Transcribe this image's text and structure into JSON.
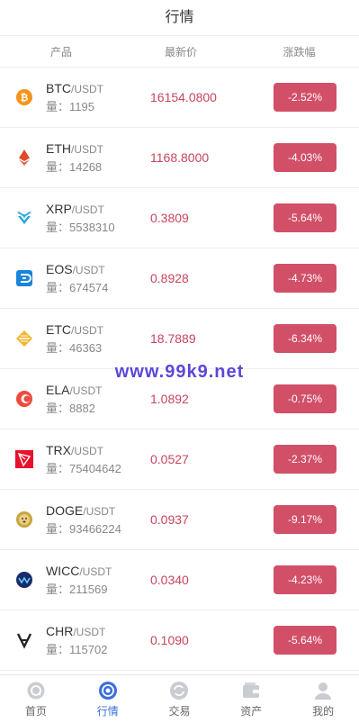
{
  "header": {
    "title": "行情"
  },
  "columns": {
    "product": "产品",
    "latest_price": "最新价",
    "change": "涨跌幅"
  },
  "volume_label": "量：",
  "coins": [
    {
      "symbol": "BTC",
      "quote": "/USDT",
      "volume": "1195",
      "price": "16154.0800",
      "change": "-2.52%",
      "icon": "btc-icon",
      "color": "#f7931a"
    },
    {
      "symbol": "ETH",
      "quote": "/USDT",
      "volume": "14268",
      "price": "1168.8000",
      "change": "-4.03%",
      "icon": "eth-icon",
      "color": "#e2482b"
    },
    {
      "symbol": "XRP",
      "quote": "/USDT",
      "volume": "5538310",
      "price": "0.3809",
      "change": "-5.64%",
      "icon": "xrp-icon",
      "color": "#2aa7de"
    },
    {
      "symbol": "EOS",
      "quote": "/USDT",
      "volume": "674574",
      "price": "0.8928",
      "change": "-4.73%",
      "icon": "eos-icon",
      "color": "#1a84d8"
    },
    {
      "symbol": "ETC",
      "quote": "/USDT",
      "volume": "46363",
      "price": "18.7889",
      "change": "-6.34%",
      "icon": "etc-icon",
      "color": "#f3b52c"
    },
    {
      "symbol": "ELA",
      "quote": "/USDT",
      "volume": "8882",
      "price": "1.0892",
      "change": "-0.75%",
      "icon": "ela-icon",
      "color": "#ef4a3c"
    },
    {
      "symbol": "TRX",
      "quote": "/USDT",
      "volume": "75404642",
      "price": "0.0527",
      "change": "-2.37%",
      "icon": "trx-icon",
      "color": "#e8112d"
    },
    {
      "symbol": "DOGE",
      "quote": "/USDT",
      "volume": "93466224",
      "price": "0.0937",
      "change": "-9.17%",
      "icon": "doge-icon",
      "color": "#c9a53a"
    },
    {
      "symbol": "WICC",
      "quote": "/USDT",
      "volume": "211569",
      "price": "0.0340",
      "change": "-4.23%",
      "icon": "wicc-icon",
      "color": "#1a2a6b"
    },
    {
      "symbol": "CHR",
      "quote": "/USDT",
      "volume": "115702",
      "price": "0.1090",
      "change": "-5.64%",
      "icon": "chr-icon",
      "color": "#222222"
    }
  ],
  "watermark": "www.99k9.net",
  "tabs": [
    {
      "label": "首页",
      "icon": "home-icon"
    },
    {
      "label": "行情",
      "icon": "market-icon",
      "active": true
    },
    {
      "label": "交易",
      "icon": "trade-icon"
    },
    {
      "label": "资产",
      "icon": "wallet-icon"
    },
    {
      "label": "我的",
      "icon": "user-icon"
    }
  ],
  "colors": {
    "accent": "#3a6fd8",
    "price": "#c7455c",
    "change_bg": "#d24f68"
  }
}
